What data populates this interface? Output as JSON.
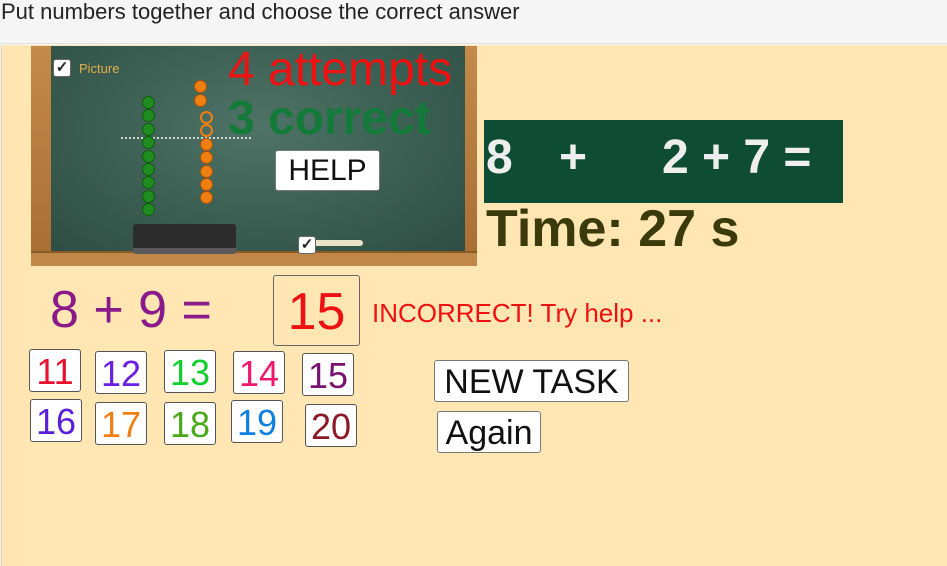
{
  "instruction": "Put numbers together and choose the correct answer",
  "board": {
    "picture_checked": true,
    "picture_label": "Picture",
    "board_checkbox_checked": true,
    "attempts": "4 attempts",
    "correct": "3 correct",
    "help_label": "HELP"
  },
  "task": {
    "a": "8",
    "plus": "+",
    "b": "2 + 7 ="
  },
  "timer": "Time: 27 s",
  "equation": "8 + 9 =",
  "answer": "15",
  "feedback": "INCORRECT! Try help ...",
  "choices": [
    {
      "label": "11",
      "color": "#e8102f"
    },
    {
      "label": "12",
      "color": "#6a1fe0"
    },
    {
      "label": "13",
      "color": "#0fcf2c"
    },
    {
      "label": "14",
      "color": "#f0186e"
    },
    {
      "label": "15",
      "color": "#7a1070"
    },
    {
      "label": "16",
      "color": "#5a1fd8"
    },
    {
      "label": "17",
      "color": "#f07f12"
    },
    {
      "label": "18",
      "color": "#4aa81a"
    },
    {
      "label": "19",
      "color": "#1080e0"
    },
    {
      "label": "20",
      "color": "#8a1a28"
    }
  ],
  "buttons": {
    "new_task": "NEW TASK",
    "again": "Again"
  },
  "colors": {
    "background": "#ffe6b3",
    "task_box": "#0e4d33",
    "incorrect": "#ee1111",
    "correct": "#137a3a",
    "equation": "#8a1a8a"
  }
}
